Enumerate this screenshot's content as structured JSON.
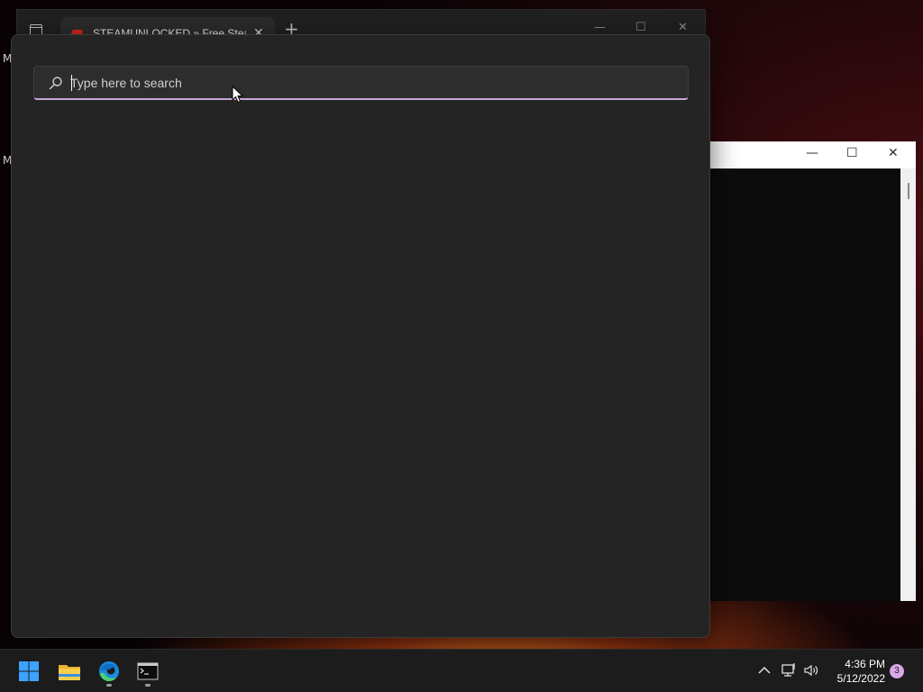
{
  "desktop": {
    "icon_label_1": "M",
    "icon_label_2": "M"
  },
  "browser": {
    "tab_title": "STEAMUNLOCKED » Free Steam",
    "tab_close_glyph": "✕",
    "new_tab_glyph": "+",
    "minimize_glyph": "—",
    "maximize_glyph": "☐",
    "close_glyph": "✕",
    "favicon_color": "#d4221c"
  },
  "console": {
    "minimize_glyph": "—",
    "maximize_glyph": "☐",
    "close_glyph": "✕"
  },
  "search": {
    "placeholder": "Type here to search",
    "value": "",
    "accent_color": "#c9a7d8"
  },
  "taskbar": {
    "apps": [
      {
        "name": "start-button",
        "icon": "windows-logo-icon"
      },
      {
        "name": "file-explorer",
        "icon": "folder-icon"
      },
      {
        "name": "microsoft-edge",
        "icon": "edge-icon"
      },
      {
        "name": "command-prompt",
        "icon": "terminal-icon"
      }
    ],
    "time": "4:36 PM",
    "date": "5/12/2022",
    "notification_count": "3"
  }
}
